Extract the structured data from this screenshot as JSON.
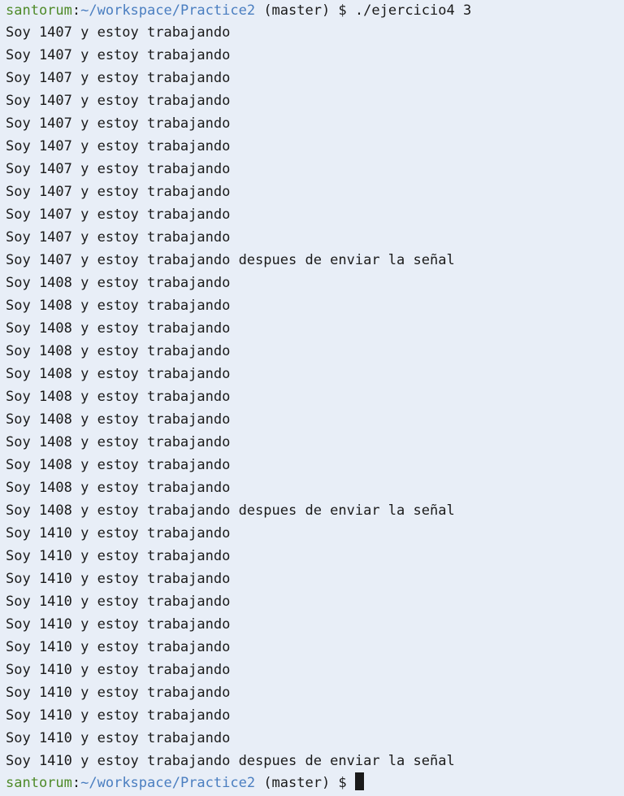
{
  "prompt": {
    "user": "santorum",
    "separator": ":",
    "path": "~/workspace/Practice2",
    "branch": " (master) $ ",
    "command": "./ejercicio4 3"
  },
  "output": [
    "Soy 1407 y estoy trabajando",
    "Soy 1407 y estoy trabajando",
    "Soy 1407 y estoy trabajando",
    "Soy 1407 y estoy trabajando",
    "Soy 1407 y estoy trabajando",
    "Soy 1407 y estoy trabajando",
    "Soy 1407 y estoy trabajando",
    "Soy 1407 y estoy trabajando",
    "Soy 1407 y estoy trabajando",
    "Soy 1407 y estoy trabajando",
    "Soy 1407 y estoy trabajando despues de enviar la señal",
    "Soy 1408 y estoy trabajando",
    "Soy 1408 y estoy trabajando",
    "Soy 1408 y estoy trabajando",
    "Soy 1408 y estoy trabajando",
    "Soy 1408 y estoy trabajando",
    "Soy 1408 y estoy trabajando",
    "Soy 1408 y estoy trabajando",
    "Soy 1408 y estoy trabajando",
    "Soy 1408 y estoy trabajando",
    "Soy 1408 y estoy trabajando",
    "Soy 1408 y estoy trabajando despues de enviar la señal",
    "Soy 1410 y estoy trabajando",
    "Soy 1410 y estoy trabajando",
    "Soy 1410 y estoy trabajando",
    "Soy 1410 y estoy trabajando",
    "Soy 1410 y estoy trabajando",
    "Soy 1410 y estoy trabajando",
    "Soy 1410 y estoy trabajando",
    "Soy 1410 y estoy trabajando",
    "Soy 1410 y estoy trabajando",
    "Soy 1410 y estoy trabajando",
    "Soy 1410 y estoy trabajando despues de enviar la señal"
  ],
  "final_prompt": {
    "user": "santorum",
    "separator": ":",
    "path": "~/workspace/Practice2",
    "branch": " (master) $ "
  },
  "colors": {
    "background": "#e8eef7",
    "user": "#4e8a28",
    "path": "#4a7ec0",
    "text": "#1a1a1a"
  }
}
